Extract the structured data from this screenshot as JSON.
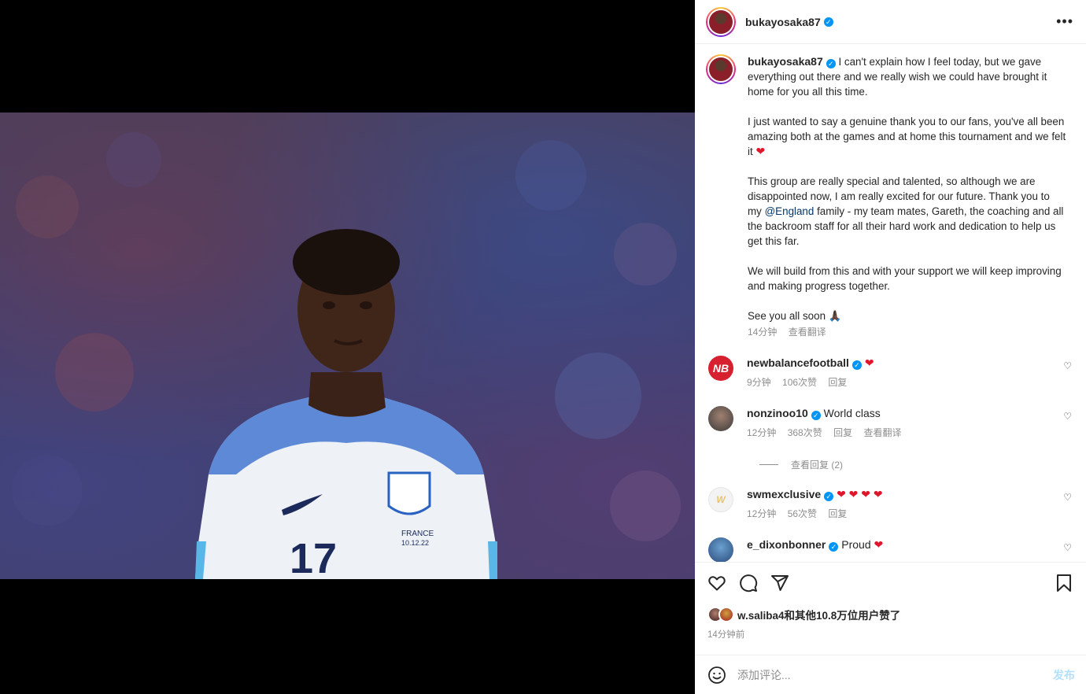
{
  "post": {
    "username": "bukayosaka87",
    "more_icon": "more-horizontal-icon"
  },
  "caption": {
    "username": "bukayosaka87",
    "p1": "I can't explain how I feel today, but we gave everything out there and we really wish we could have brought it home for you all this time.",
    "p2": "I just wanted to say a genuine thank you to our fans, you've all been amazing both at the games and at home this tournament and we felt it",
    "p2_emoji": "❤",
    "p3_a": "This group are really special and talented, so although we are disappointed now, I am really excited for our future. Thank you to my",
    "p3_mention": "@England",
    "p3_b": "family - my team mates, Gareth, the coaching and all the backroom staff for all their hard work and dedication to help us get this far.",
    "p4": "We will build from this and with your support we will keep improving and making progress together.",
    "p5": "See you all soon",
    "p5_emoji": "🙏🏿",
    "time": "14分钟",
    "translate": "查看翻译"
  },
  "comments": [
    {
      "username": "newbalancefootball",
      "text": "",
      "emoji": "❤",
      "time": "9分钟",
      "likes": "106次赞",
      "reply": "回复",
      "translate": ""
    },
    {
      "username": "nonzinoo10",
      "text": "World class",
      "emoji": "",
      "time": "12分钟",
      "likes": "368次赞",
      "reply": "回复",
      "translate": "查看翻译",
      "view_replies": "查看回复 (2)"
    },
    {
      "username": "swmexclusive",
      "text": "",
      "emoji": "❤ ❤ ❤ ❤",
      "time": "12分钟",
      "likes": "56次赞",
      "reply": "回复",
      "translate": ""
    },
    {
      "username": "e_dixonbonner",
      "text": "Proud",
      "emoji": "❤",
      "time": "",
      "likes": "",
      "reply": "",
      "translate": ""
    }
  ],
  "actions": {
    "like_icon": "heart-icon",
    "comment_icon": "comment-icon",
    "share_icon": "send-icon",
    "save_icon": "bookmark-icon"
  },
  "likes_text": "w.saliba4和其他10.8万位用户赞了",
  "time_ago": "14分钟前",
  "add_comment": {
    "placeholder": "添加评论...",
    "post_label": "发布",
    "emoji_icon": "smile-icon"
  },
  "photo": {
    "jersey_number": "17",
    "jersey_text": "FRANCE",
    "jersey_date": "10.12.22"
  },
  "colors": {
    "verified": "#0095f6",
    "heart": "#e0162b",
    "post_disabled": "#b2dffc",
    "mention": "#00376b"
  }
}
